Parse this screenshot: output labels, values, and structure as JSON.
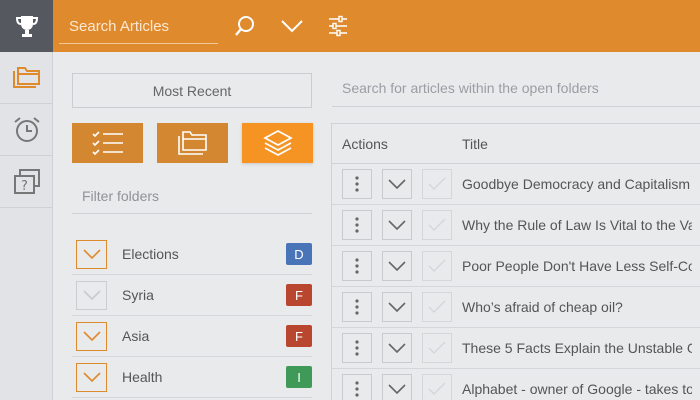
{
  "topbar": {
    "search_placeholder": "Search Articles"
  },
  "panel": {
    "most_recent_label": "Most Recent",
    "filter_label": "Filter folders",
    "folders": [
      {
        "name": "Elections",
        "badge": "D",
        "badge_color": "#4a74b8",
        "expanded_color": "orange"
      },
      {
        "name": "Syria",
        "badge": "F",
        "badge_color": "#b9472f",
        "expanded_color": "gray"
      },
      {
        "name": "Asia",
        "badge": "F",
        "badge_color": "#b9472f",
        "expanded_color": "orange"
      },
      {
        "name": "Health",
        "badge": "I",
        "badge_color": "#3e9a56",
        "expanded_color": "orange"
      }
    ]
  },
  "articles": {
    "search_placeholder": "Search for articles within the open folders",
    "header_actions": "Actions",
    "header_title": "Title",
    "rows": [
      {
        "title": "Goodbye Democracy and Capitalism"
      },
      {
        "title": "Why the Rule of Law Is Vital to the Va"
      },
      {
        "title": "Poor People Don't Have Less Self-Co"
      },
      {
        "title": "Who’s afraid of cheap oil?"
      },
      {
        "title": "These 5 Facts Explain the Unstable G"
      },
      {
        "title": "Alphabet - owner of Google - takes to"
      }
    ]
  },
  "colors": {
    "accent": "#e08a2e",
    "accent_active": "#f59323",
    "rail_dark": "#55595f"
  }
}
